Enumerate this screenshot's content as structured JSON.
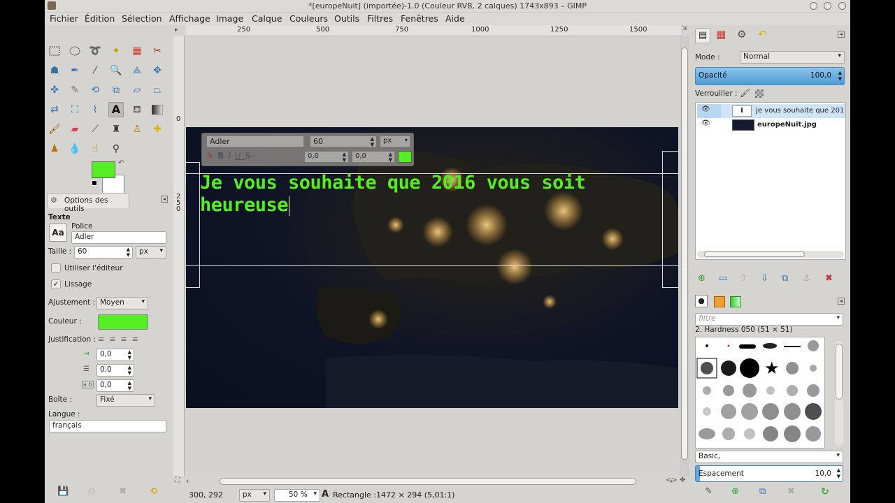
{
  "window": {
    "title": "*[europeNuit] (importée)-1.0 (Couleur RVB, 2 calques) 1743x893 – GIMP"
  },
  "menu": [
    "Fichier",
    "Édition",
    "Sélection",
    "Affichage",
    "Image",
    "Calque",
    "Couleurs",
    "Outils",
    "Filtres",
    "Fenêtres",
    "Aide"
  ],
  "colors": {
    "fg": "#55ee22",
    "text": "#55ee22",
    "accent": "#5aa8e0"
  },
  "tool_options": {
    "header": "Options des outils",
    "section": "Texte",
    "font_label": "Police",
    "font_value": "Adler",
    "size_label": "Taille :",
    "size_value": "60",
    "size_unit": "px",
    "editor_label": "Utiliser l'éditeur",
    "smooth_label": "Lissage",
    "hinting_label": "Ajustement :",
    "hinting_value": "Moyen",
    "color_label": "Couleur :",
    "justify_label": "Justification :",
    "indent_value": "0,0",
    "line_spacing_value": "0,0",
    "letter_spacing_value": "0,0",
    "box_label": "Boîte :",
    "box_value": "Fixé",
    "lang_label": "Langue :",
    "lang_value": "français"
  },
  "text_toolbar": {
    "font": "Adler",
    "size": "60",
    "unit": "px",
    "baseline": "0,0",
    "kerning": "0,0"
  },
  "canvas_text": {
    "line1": "Je vous souhaite que 2016 vous soit",
    "line2": "heureuse"
  },
  "ruler": {
    "h": [
      "250",
      "500",
      "750",
      "1000",
      "1250",
      "1500"
    ],
    "v_top": "0",
    "v": [
      "2",
      "5",
      "0"
    ]
  },
  "status": {
    "coords": "300, 292",
    "unit": "px",
    "zoom": "50 %",
    "message": "Rectangle :1472 × 294  (5,01:1)"
  },
  "layers": {
    "mode_label": "Mode :",
    "mode_value": "Normal",
    "opacity_label": "Opacité",
    "opacity_value": "100,0",
    "lock_label": "Verrouiller :",
    "items": [
      {
        "name": "Je vous souhaite que 201",
        "bold": false
      },
      {
        "name": "europeNuit.jpg",
        "bold": true
      }
    ]
  },
  "brushes": {
    "filter_placeholder": "filtre",
    "current": "2. Hardness 050 (51 × 51)",
    "preset": "Basic,",
    "spacing_label": "Espacement",
    "spacing_value": "10,0"
  }
}
